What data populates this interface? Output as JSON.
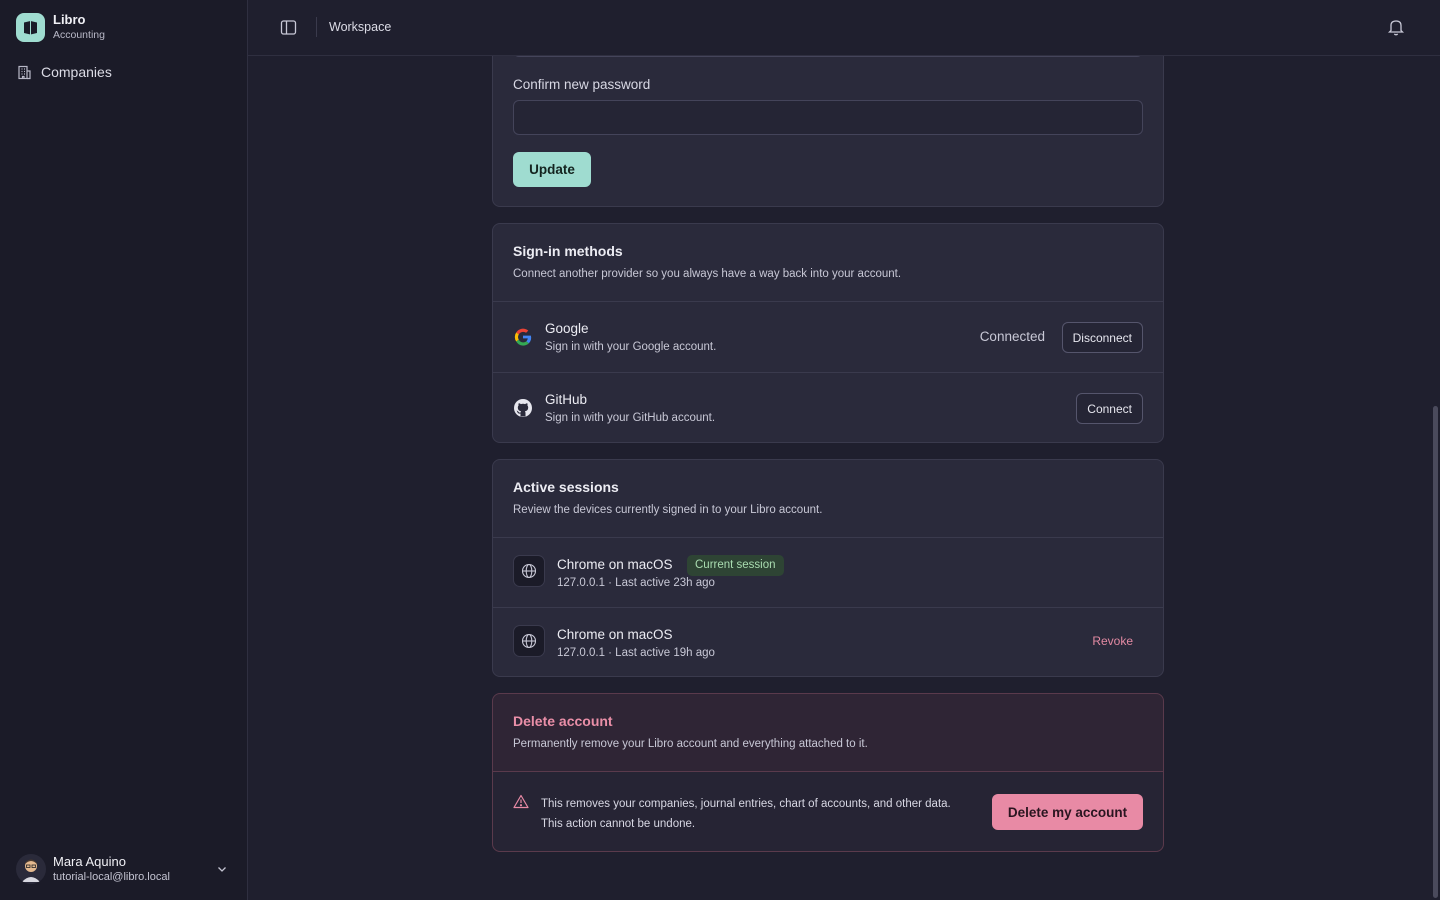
{
  "sidebar": {
    "brand": {
      "name": "Libro",
      "subtitle": "Accounting"
    },
    "nav": [
      {
        "label": "Companies",
        "icon": "building-icon"
      }
    ],
    "user": {
      "name": "Mara Aquino",
      "email": "tutorial-local@libro.local"
    }
  },
  "topbar": {
    "breadcrumb": "Workspace"
  },
  "password": {
    "confirm_label": "Confirm new password",
    "confirm_value": "",
    "update_label": "Update"
  },
  "signin": {
    "title": "Sign-in methods",
    "description": "Connect another provider so you always have a way back into your account.",
    "providers": [
      {
        "name": "Google",
        "description": "Sign in with your Google account.",
        "status": "Connected",
        "action": "Disconnect",
        "icon": "google-icon"
      },
      {
        "name": "GitHub",
        "description": "Sign in with your GitHub account.",
        "status": "",
        "action": "Connect",
        "icon": "github-icon"
      }
    ]
  },
  "sessions": {
    "title": "Active sessions",
    "description": "Review the devices currently signed in to your Libro account.",
    "items": [
      {
        "name": "Chrome on macOS",
        "meta": "127.0.0.1 · Last active 23h ago",
        "badge": "Current session"
      },
      {
        "name": "Chrome on macOS",
        "meta": "127.0.0.1 · Last active 19h ago",
        "action": "Revoke"
      }
    ]
  },
  "delete": {
    "title": "Delete account",
    "description": "Permanently remove your Libro account and everything attached to it.",
    "warning_line1": "This removes your companies, journal entries, chart of accounts, and other data.",
    "warning_line2": "This action cannot be undone.",
    "button": "Delete my account"
  },
  "colors": {
    "accent": "#9fdcd0",
    "danger": "#e88aa5",
    "background": "#1f1f2e"
  }
}
